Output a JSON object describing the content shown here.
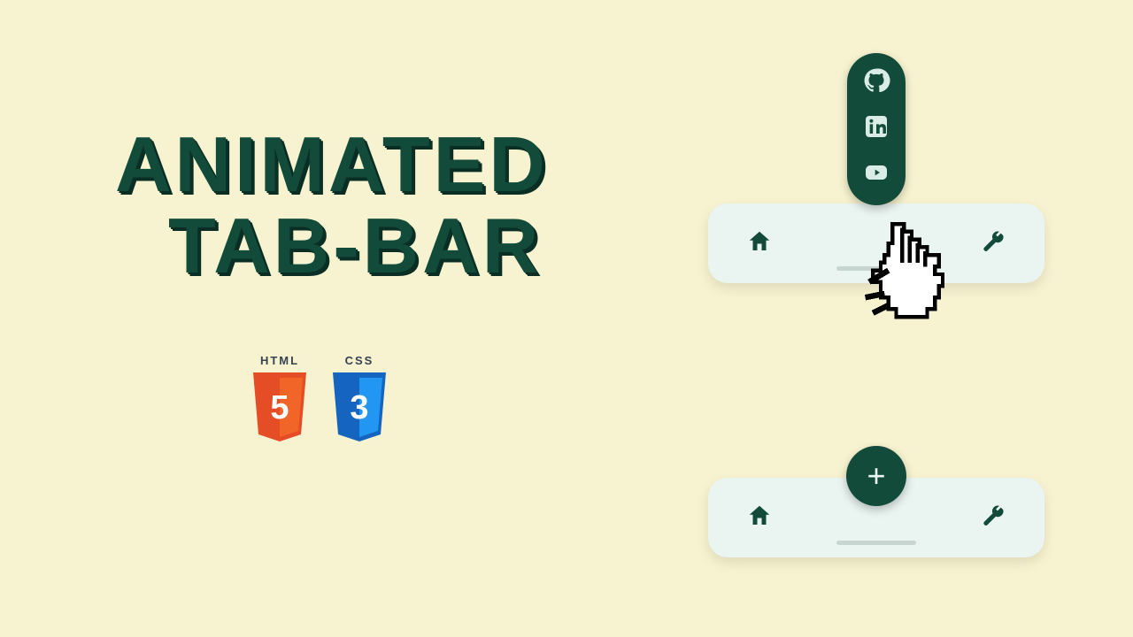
{
  "headline": {
    "line1": "Animated",
    "line2": "Tab-Bar"
  },
  "tech": {
    "html": {
      "label": "HTML",
      "glyph": "5",
      "color_top": "#e44d26",
      "color_bottom": "#f16529"
    },
    "css": {
      "label": "CSS",
      "glyph": "3",
      "color_top": "#1565c0",
      "color_bottom": "#2196f3"
    }
  },
  "tabbar": {
    "home_icon": "home-icon",
    "tool_icon": "wrench-icon",
    "fab_plus": "+"
  },
  "social": {
    "github": "github-icon",
    "linkedin": "linkedin-icon",
    "youtube": "youtube-icon"
  },
  "colors": {
    "bg": "#f7f3d0",
    "accent": "#134b3b",
    "surface": "#eaf4f1"
  }
}
